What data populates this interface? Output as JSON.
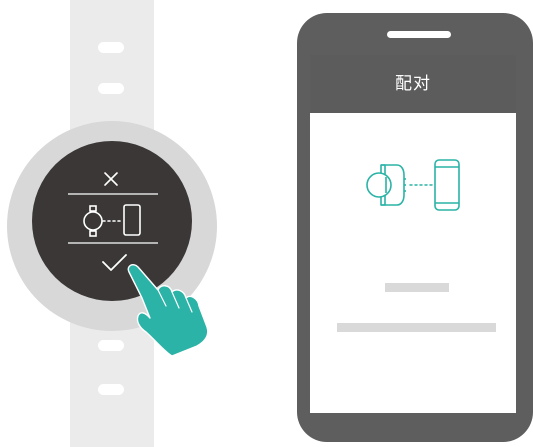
{
  "phone": {
    "title": "配对"
  },
  "watch": {
    "cancel_icon": "close-icon",
    "confirm_icon": "check-icon",
    "pair_icon": "watch-phone-pair-icon"
  },
  "colors": {
    "accent": "#2ab3a6",
    "watch_face": "#3a3736",
    "bezel": "#d8d8d8",
    "strap": "#ebebeb",
    "phone_body": "#5e5e5e"
  }
}
